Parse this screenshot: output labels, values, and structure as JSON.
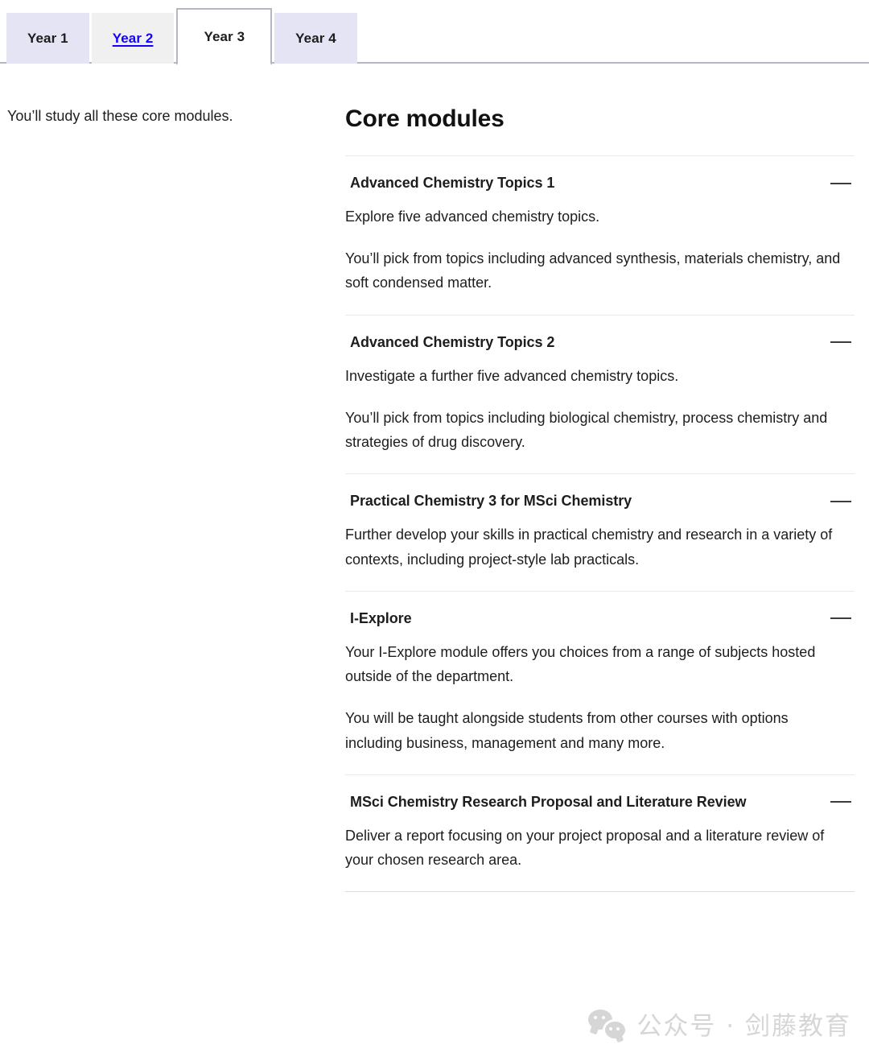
{
  "tabs": {
    "items": [
      {
        "label": "Year 1",
        "state": "default"
      },
      {
        "label": "Year 2",
        "state": "hovered"
      },
      {
        "label": "Year 3",
        "state": "active"
      },
      {
        "label": "Year 4",
        "state": "default"
      }
    ]
  },
  "left": {
    "intro": "You’ll study all these core modules."
  },
  "main": {
    "section_title": "Core modules",
    "toggle_icon": "minus-icon",
    "modules": [
      {
        "title": "Advanced Chemistry Topics 1",
        "paragraphs": [
          "Explore five advanced chemistry topics.",
          "You’ll pick from topics including advanced synthesis, materials chemistry, and soft condensed matter."
        ]
      },
      {
        "title": "Advanced Chemistry Topics 2",
        "paragraphs": [
          "Investigate a further five advanced chemistry topics.",
          "You’ll pick from topics including biological chemistry, process chemistry and strategies of drug discovery."
        ]
      },
      {
        "title": "Practical Chemistry 3 for MSci Chemistry",
        "paragraphs": [
          "Further develop your skills in practical chemistry and research in a variety of contexts, including project-style lab practicals."
        ]
      },
      {
        "title": "I-Explore",
        "paragraphs": [
          "Your I-Explore module offers you choices from a range of subjects hosted outside of the department.",
          "You will be taught alongside students from other courses with options including business, management and many more."
        ]
      },
      {
        "title": "MSci Chemistry Research Proposal and Literature Review",
        "paragraphs": [
          "Deliver a report focusing on your project proposal and a literature review of your chosen research area."
        ]
      }
    ]
  },
  "watermark": {
    "icon": "wechat-icon",
    "text": "公众号 · 剑藤教育"
  },
  "colors": {
    "tab_default_bg": "#e4e4f4",
    "tab_hover_bg": "#f0f0f0",
    "tab_active_bg": "#ffffff",
    "tab_border": "#b5b8c4",
    "link_blue": "#1400ff",
    "divider": "#e8eaee",
    "text": "#1d1d1d",
    "watermark": "#bdbdbd"
  }
}
